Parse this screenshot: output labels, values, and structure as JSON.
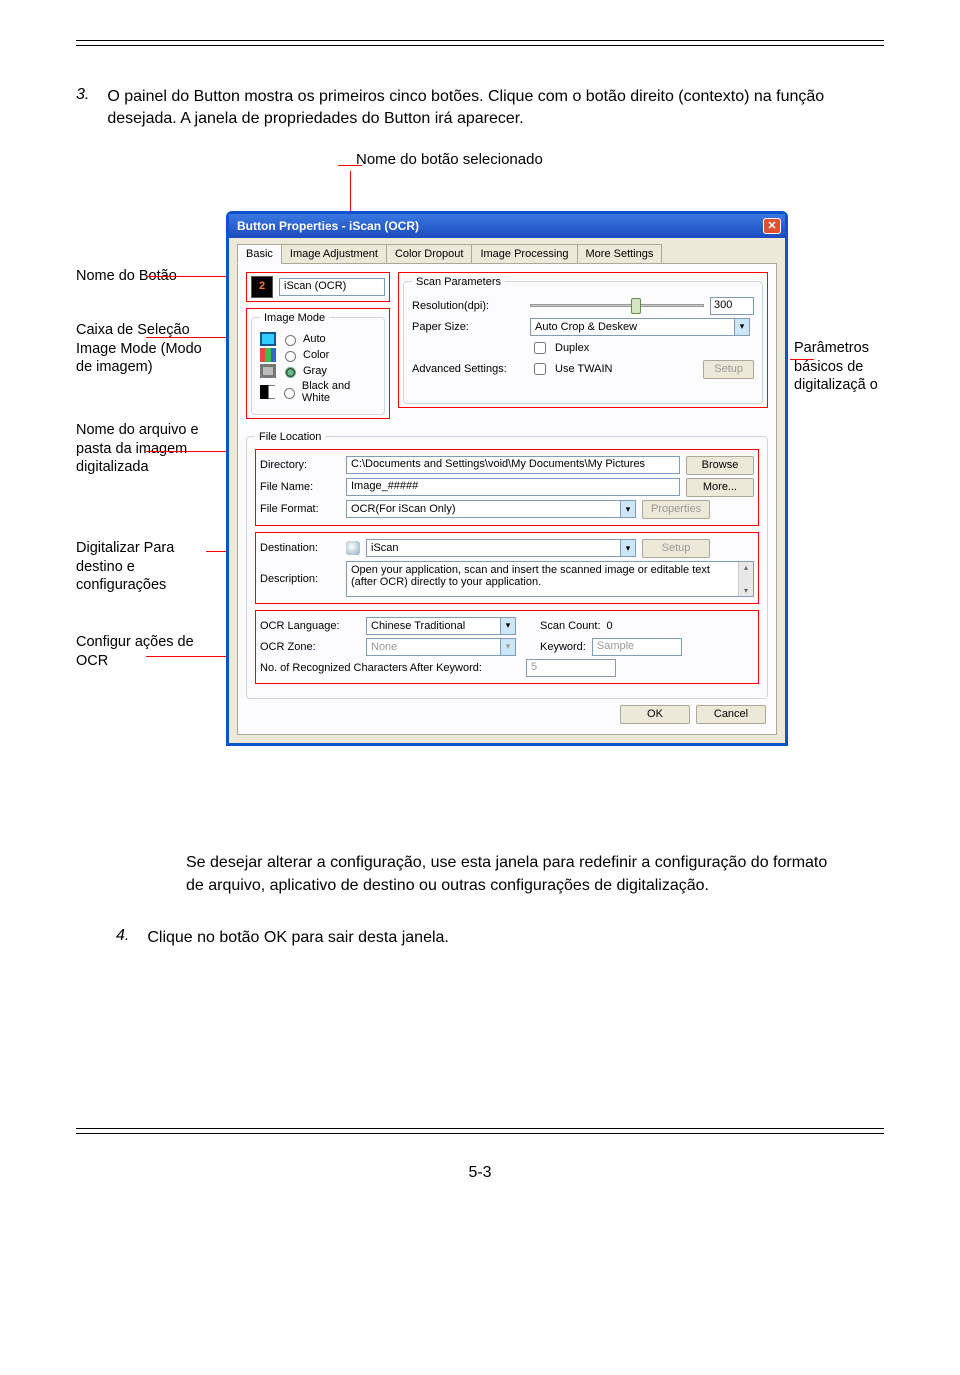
{
  "step3": {
    "num": "3.",
    "text": "O painel do Button mostra os primeiros cinco botões. Clique com o botão direito (contexto) na função desejada. A janela de propriedades do Button irá aparecer."
  },
  "callouts": {
    "top": "Nome do botão selecionado",
    "left1": "Nome do Botão",
    "left2": "Caixa de Seleção Image Mode (Modo de imagem)",
    "left3": "Nome do arquivo e pasta da imagem digitalizada",
    "left4": "Digitalizar Para destino e configurações",
    "left5": "Configur ações de OCR",
    "right": "Parâmetros básicos de digitalizaçã o"
  },
  "window": {
    "title": "Button Properties - iScan (OCR)",
    "tabs": [
      "Basic",
      "Image Adjustment",
      "Color Dropout",
      "Image Processing",
      "More Settings"
    ],
    "button_number": "2",
    "button_name": "iScan (OCR)",
    "image_mode": {
      "legend": "Image Mode",
      "options": [
        "Auto",
        "Color",
        "Gray",
        "Black and White"
      ],
      "selected": "Gray"
    },
    "scan_params": {
      "legend": "Scan Parameters",
      "resolution_label": "Resolution(dpi):",
      "resolution_value": "300",
      "paper_label": "Paper Size:",
      "paper_value": "Auto Crop & Deskew",
      "duplex_label": "Duplex",
      "adv_label": "Advanced Settings:",
      "use_twain_label": "Use TWAIN",
      "setup_btn": "Setup"
    },
    "file_loc": {
      "legend": "File Location",
      "dir_label": "Directory:",
      "dir_value": "C:\\Documents and Settings\\void\\My Documents\\My Pictures",
      "browse_btn": "Browse",
      "fname_label": "File Name:",
      "fname_value": "Image_#####",
      "more_btn": "More...",
      "fmt_label": "File Format:",
      "fmt_value": "OCR(For iScan Only)",
      "props_btn": "Properties",
      "dest_label": "Destination:",
      "dest_value": "iScan",
      "dest_setup_btn": "Setup",
      "desc_label": "Description:",
      "desc_value": "Open your application, scan and insert the scanned image or editable text (after OCR) directly to your application."
    },
    "ocr": {
      "lang_label": "OCR Language:",
      "lang_value": "Chinese Traditional",
      "count_label": "Scan Count:",
      "count_value": "0",
      "zone_label": "OCR Zone:",
      "zone_value": "None",
      "kw_label": "Keyword:",
      "kw_value": "Sample",
      "after_label": "No. of Recognized Characters After Keyword:",
      "after_value": "5"
    },
    "ok_btn": "OK",
    "cancel_btn": "Cancel"
  },
  "after_para": "Se desejar alterar a configuração, use esta janela para redefinir a configuração do formato de arquivo, aplicativo de destino ou outras configurações de digitalização.",
  "step4": {
    "num": "4.",
    "text": "Clique no botão OK para sair desta janela."
  },
  "page_number": "5-3"
}
